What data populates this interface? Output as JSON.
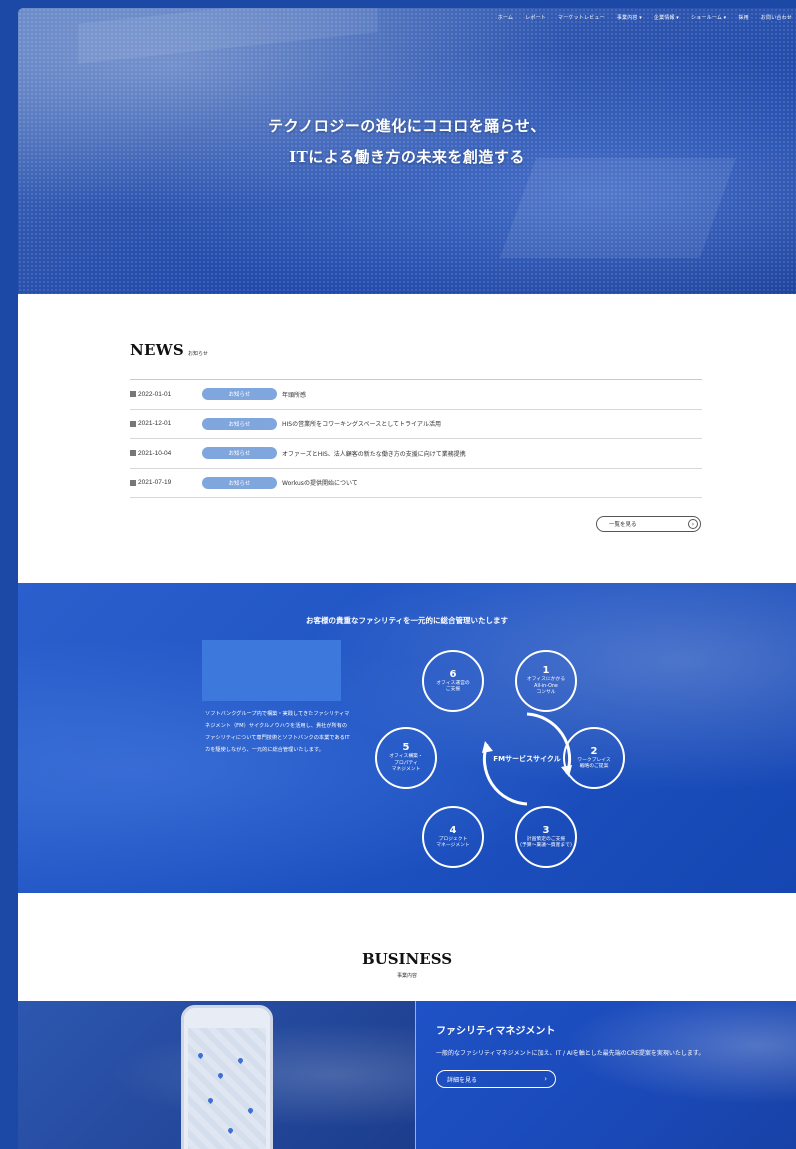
{
  "nav": {
    "items": [
      "ホーム",
      "レポート",
      "マーケットレビュー",
      "事業内容 ▾",
      "企業情報 ▾",
      "ショールーム ▾",
      "採用",
      "お問い合わせ"
    ]
  },
  "hero": {
    "title_line1": "テクノロジーの進化にココロを踊らせ、",
    "title_line2": "ITによる働き方の未来を創造する"
  },
  "news": {
    "title": "NEWS",
    "subtitle": "お知らせ",
    "items": [
      {
        "date": "2022-01-01",
        "badge": "お知らせ",
        "text": "年頭所感"
      },
      {
        "date": "2021-12-01",
        "badge": "お知らせ",
        "text": "HISの営業所をコワーキングスペースとしてトライアル活用"
      },
      {
        "date": "2021-10-04",
        "badge": "お知らせ",
        "text": "オファーズとHIS、法人顧客の新たな働き方の支援に向けて業務提携"
      },
      {
        "date": "2021-07-19",
        "badge": "お知らせ",
        "text": "Workusの提供開始について"
      }
    ],
    "more_label": "一覧を見る",
    "more_arrow": "›"
  },
  "fm": {
    "title": "お客様の貴重なファシリティを一元的に総合管理いたします",
    "description": "ソフトバンクグループ内で構築・実践してきたファシリティマネジメント（FM）サイクルノウハウを活用し、貴社が所有のファシリティについて専門技術とソフトバンクの本業であるITカを駆使しながら、一元的に総合管理いたします。",
    "center_label": "FMサービスサイクル",
    "steps": [
      {
        "num": "1",
        "label": "オフィスにかかる\nAll-in-One\nコンサル"
      },
      {
        "num": "2",
        "label": "ワークプレイス\n戦略のご提案"
      },
      {
        "num": "3",
        "label": "計画策定のご支援\n(予算〜稟議〜資産まで)"
      },
      {
        "num": "4",
        "label": "プロジェクト\nマネージメント"
      },
      {
        "num": "5",
        "label": "オフィス構築・\nプロパティ\nマネジメント"
      },
      {
        "num": "6",
        "label": "オフィス運営の\nご支援"
      }
    ]
  },
  "business": {
    "title": "BUSINESS",
    "subtitle": "事業内容",
    "card": {
      "title": "ファシリティマネジメント",
      "text": "一般的なファシリティマネジメントに加え、IT / AIを軸とした最先端のCRE提案を実現いたします。",
      "button": "詳細を見る",
      "button_chevron": "›"
    }
  }
}
